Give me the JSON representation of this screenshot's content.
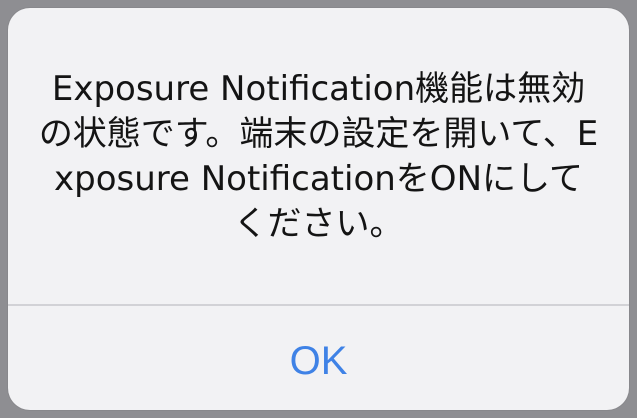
{
  "alert": {
    "message": "Exposure Notification機能は無効の状態です。端末の設定を開いて、Exposure NotificationをONにしてください。",
    "ok_label": "OK"
  },
  "colors": {
    "background_dim": "#8e8e92",
    "alert_background": "#f2f2f4",
    "text": "#141414",
    "divider": "#d2d2d6",
    "accent": "#3f82e6"
  }
}
